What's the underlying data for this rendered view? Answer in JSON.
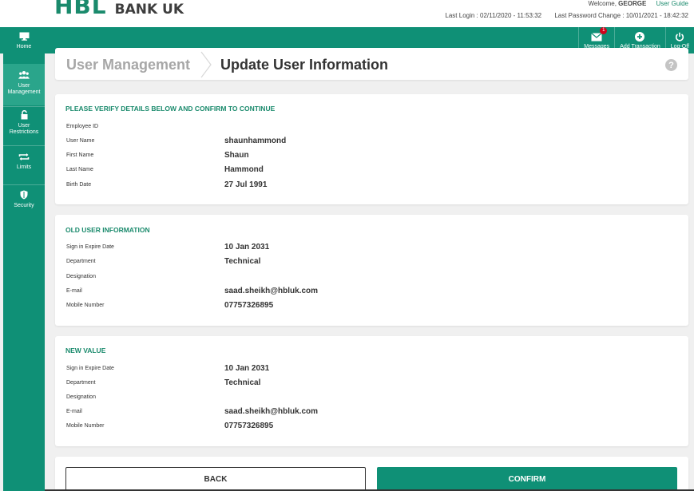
{
  "brand": {
    "logo": "HBL",
    "suffix": "BANK UK"
  },
  "header": {
    "welcome_prefix": "Welcome,",
    "user": "GEORGE",
    "user_guide": "User Guide",
    "last_login": "Last Login : 02/11/2020 - 11:53:32",
    "last_password_change": "Last Password Change : 10/01/2021 - 18:42:32"
  },
  "topnav": {
    "messages": {
      "label": "Messages",
      "badge": "1",
      "icon": "envelope-icon"
    },
    "add_transaction": {
      "label": "Add Transaction",
      "icon": "plus-circle-icon"
    },
    "logoff": {
      "label": "Log-Off",
      "icon": "power-icon"
    }
  },
  "sidebar": {
    "items": [
      {
        "label": "Home",
        "icon": "monitor-icon"
      },
      {
        "label": "User Management",
        "icon": "users-icon",
        "active": true
      },
      {
        "label": "User Restrictions",
        "icon": "unlock-icon"
      },
      {
        "label": "Limits",
        "icon": "repeat-icon"
      },
      {
        "label": "Security",
        "icon": "shield-icon"
      }
    ]
  },
  "breadcrumb": {
    "parent": "User Management",
    "current": "Update User Information",
    "help": "?"
  },
  "verify": {
    "title": "PLEASE VERIFY DETAILS BELOW AND CONFIRM TO CONTINUE",
    "rows": [
      {
        "label": "Employee ID",
        "value": ""
      },
      {
        "label": "User Name",
        "value": "shaunhammond"
      },
      {
        "label": "First Name",
        "value": "Shaun"
      },
      {
        "label": "Last Name",
        "value": "Hammond"
      },
      {
        "label": "Birth Date",
        "value": "27 Jul 1991"
      }
    ]
  },
  "old_info": {
    "title": "OLD USER INFORMATION",
    "rows": [
      {
        "label": "Sign in Expire Date",
        "value": "10 Jan 2031"
      },
      {
        "label": "Department",
        "value": "Technical"
      },
      {
        "label": "Designation",
        "value": ""
      },
      {
        "label": "E-mail",
        "value": "saad.sheikh@hbluk.com"
      },
      {
        "label": "Mobile Number",
        "value": "07757326895"
      }
    ]
  },
  "new_value": {
    "title": "NEW VALUE",
    "rows": [
      {
        "label": "Sign in Expire Date",
        "value": "10 Jan 2031"
      },
      {
        "label": "Department",
        "value": "Technical"
      },
      {
        "label": "Designation",
        "value": ""
      },
      {
        "label": "E-mail",
        "value": "saad.sheikh@hbluk.com"
      },
      {
        "label": "Mobile Number",
        "value": "07757326895"
      }
    ]
  },
  "actions": {
    "back": "BACK",
    "confirm": "CONFIRM"
  },
  "colors": {
    "primary": "#0f9076",
    "accent_text": "#1a8a6c",
    "badge": "#d0021b"
  }
}
